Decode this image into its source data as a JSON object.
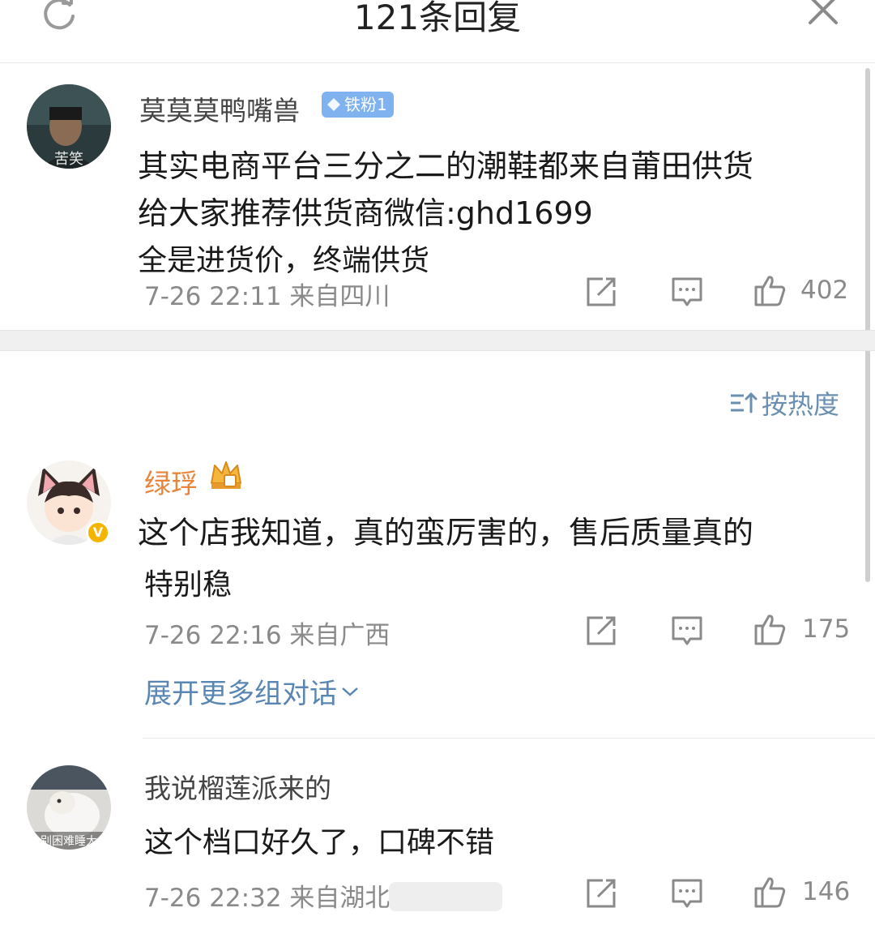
{
  "header": {
    "title": "121条回复",
    "refresh_icon": "refresh-icon",
    "close_icon": "close-icon"
  },
  "main_comment": {
    "avatar_caption": "苦笑",
    "username": "莫莫莫鸭嘴兽",
    "badge": "铁粉1",
    "lines": [
      "其实电商平台三分之二的潮鞋都来自莆田供货",
      "给大家推荐供货商微信:ghd1699",
      "全是进货价，终端供货"
    ],
    "meta": "7-26 22:11  来自四川",
    "likes": "402"
  },
  "sort": {
    "label": "按热度",
    "icon": "sort-icon"
  },
  "replies": [
    {
      "username": "绿琈",
      "lines": [
        "这个店我知道，真的蛮厉害的，售后质量真的",
        "特别稳"
      ],
      "meta": "7-26 22:16  来自广西",
      "likes": "175",
      "expand_label": "展开更多组对话"
    },
    {
      "avatar_caption": "别困难睡大",
      "username": "我说榴莲派来的",
      "lines": [
        "这个档口好久了，口碑不错"
      ],
      "meta": "7-26 22:32  来自湖北",
      "likes": "146"
    }
  ],
  "colors": {
    "meta_gray": "#8a8a8a",
    "link_blue": "#5a86b3",
    "vip_orange": "#e8843c",
    "badge_blue": "#7fb2ee"
  }
}
